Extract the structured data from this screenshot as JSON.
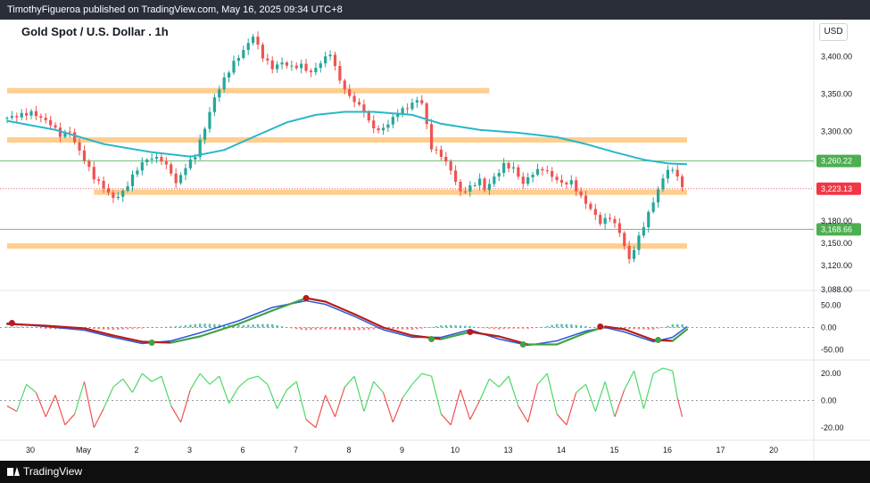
{
  "header": {
    "publisher_text": "TimothyFigueroa published on TradingView.com, May 16, 2025 09:34 UTC+8"
  },
  "chart_title": "Gold Spot / U.S. Dollar . 1h",
  "currency_label": "USD",
  "footer": {
    "brand": "TradingView"
  },
  "colors": {
    "up": "#26a69a",
    "down": "#ef5350",
    "ma": "#26b7c9",
    "zone": "#ffc57a",
    "green_level": "#4caf50",
    "red_level": "#f23645",
    "macd_fast": "#2a5bd7",
    "macd_slow_up": "#43a047",
    "macd_slow_down": "#b71c1c"
  },
  "chart_data": [
    {
      "type": "candlestick",
      "title": "Gold Spot / U.S. Dollar . 1h",
      "x_ticks": [
        "30",
        "May",
        "2",
        "3",
        "6",
        "7",
        "8",
        "9",
        "10",
        "13",
        "14",
        "15",
        "16",
        "17",
        "20"
      ],
      "y_ticks": [
        "3,400.00",
        "3,350.00",
        "3,300.00",
        "3,180.00",
        "3,150.00",
        "3,120.00",
        "3,088.00"
      ],
      "ylim": [
        3088,
        3440
      ],
      "price_path": [
        [
          0,
          3318
        ],
        [
          3,
          3322
        ],
        [
          5,
          3325
        ],
        [
          7,
          3318
        ],
        [
          9,
          3310
        ],
        [
          11,
          3295
        ],
        [
          13,
          3300
        ],
        [
          14,
          3285
        ],
        [
          16,
          3262
        ],
        [
          18,
          3238
        ],
        [
          20,
          3225
        ],
        [
          22,
          3210
        ],
        [
          24,
          3218
        ],
        [
          26,
          3240
        ],
        [
          28,
          3258
        ],
        [
          30,
          3265
        ],
        [
          32,
          3262
        ],
        [
          34,
          3245
        ],
        [
          35,
          3230
        ],
        [
          37,
          3252
        ],
        [
          39,
          3268
        ],
        [
          41,
          3305
        ],
        [
          43,
          3345
        ],
        [
          45,
          3370
        ],
        [
          47,
          3392
        ],
        [
          49,
          3408
        ],
        [
          51,
          3428
        ],
        [
          53,
          3400
        ],
        [
          55,
          3385
        ],
        [
          57,
          3392
        ],
        [
          59,
          3386
        ],
        [
          61,
          3388
        ],
        [
          63,
          3378
        ],
        [
          65,
          3392
        ],
        [
          67,
          3405
        ],
        [
          68,
          3385
        ],
        [
          70,
          3355
        ],
        [
          72,
          3340
        ],
        [
          74,
          3328
        ],
        [
          75,
          3312
        ],
        [
          77,
          3300
        ],
        [
          79,
          3310
        ],
        [
          81,
          3325
        ],
        [
          83,
          3332
        ],
        [
          85,
          3342
        ],
        [
          86,
          3338
        ],
        [
          88,
          3278
        ],
        [
          90,
          3268
        ],
        [
          92,
          3248
        ],
        [
          94,
          3218
        ],
        [
          96,
          3225
        ],
        [
          98,
          3235
        ],
        [
          99,
          3222
        ],
        [
          101,
          3238
        ],
        [
          103,
          3255
        ],
        [
          105,
          3250
        ],
        [
          107,
          3230
        ],
        [
          109,
          3244
        ],
        [
          111,
          3250
        ],
        [
          113,
          3240
        ],
        [
          115,
          3230
        ],
        [
          117,
          3232
        ],
        [
          119,
          3212
        ],
        [
          121,
          3196
        ],
        [
          123,
          3178
        ],
        [
          125,
          3185
        ],
        [
          127,
          3165
        ],
        [
          129,
          3128
        ],
        [
          131,
          3158
        ],
        [
          133,
          3190
        ],
        [
          135,
          3222
        ],
        [
          137,
          3250
        ],
        [
          139,
          3242
        ],
        [
          140,
          3223
        ]
      ],
      "moving_average": [
        [
          0,
          3314
        ],
        [
          10,
          3302
        ],
        [
          20,
          3283
        ],
        [
          30,
          3272
        ],
        [
          38,
          3266
        ],
        [
          45,
          3275
        ],
        [
          52,
          3295
        ],
        [
          58,
          3312
        ],
        [
          64,
          3322
        ],
        [
          70,
          3326
        ],
        [
          76,
          3326
        ],
        [
          84,
          3322
        ],
        [
          90,
          3310
        ],
        [
          98,
          3302
        ],
        [
          106,
          3298
        ],
        [
          114,
          3292
        ],
        [
          120,
          3283
        ],
        [
          126,
          3272
        ],
        [
          132,
          3262
        ],
        [
          137,
          3257
        ],
        [
          141,
          3256
        ]
      ],
      "zones": [
        {
          "from_x": 0,
          "to_x": 100,
          "low": 3351,
          "high": 3358
        },
        {
          "from_x": 0,
          "to_x": 141,
          "low": 3285,
          "high": 3292
        },
        {
          "from_x": 18,
          "to_x": 141,
          "low": 3215,
          "high": 3222
        },
        {
          "from_x": 0,
          "to_x": 141,
          "low": 3143,
          "high": 3150
        }
      ],
      "levels": [
        {
          "value": 3260.22,
          "label": "3,260.22",
          "color": "#4caf50",
          "style": "solid"
        },
        {
          "value": 3223.13,
          "label": "3,223.13",
          "color": "#f23645",
          "style": "dotted"
        },
        {
          "value": 3168.66,
          "label": "3,168.66",
          "color": "#4caf50",
          "style": "solid"
        }
      ]
    },
    {
      "type": "line",
      "indicator": "MACD",
      "y_ticks": [
        "50.00",
        "0.00",
        "-50.00"
      ],
      "ylim": [
        -65,
        75
      ],
      "fast_line": [
        [
          0,
          10
        ],
        [
          8,
          2
        ],
        [
          16,
          -6
        ],
        [
          22,
          -22
        ],
        [
          28,
          -36
        ],
        [
          34,
          -30
        ],
        [
          40,
          -12
        ],
        [
          48,
          15
        ],
        [
          55,
          45
        ],
        [
          62,
          60
        ],
        [
          66,
          52
        ],
        [
          72,
          25
        ],
        [
          78,
          -5
        ],
        [
          84,
          -22
        ],
        [
          90,
          -22
        ],
        [
          96,
          -5
        ],
        [
          102,
          -26
        ],
        [
          108,
          -40
        ],
        [
          114,
          -30
        ],
        [
          120,
          -8
        ],
        [
          124,
          0
        ],
        [
          128,
          -10
        ],
        [
          134,
          -32
        ],
        [
          138,
          -22
        ],
        [
          141,
          2
        ]
      ],
      "signal_line": [
        [
          0,
          8
        ],
        [
          8,
          4
        ],
        [
          16,
          -2
        ],
        [
          22,
          -18
        ],
        [
          28,
          -32
        ],
        [
          34,
          -34
        ],
        [
          40,
          -20
        ],
        [
          48,
          8
        ],
        [
          55,
          38
        ],
        [
          62,
          66
        ],
        [
          66,
          58
        ],
        [
          72,
          30
        ],
        [
          78,
          0
        ],
        [
          84,
          -18
        ],
        [
          90,
          -26
        ],
        [
          96,
          -10
        ],
        [
          102,
          -20
        ],
        [
          108,
          -38
        ],
        [
          114,
          -38
        ],
        [
          120,
          -12
        ],
        [
          124,
          2
        ],
        [
          128,
          -4
        ],
        [
          134,
          -28
        ],
        [
          138,
          -30
        ],
        [
          141,
          -4
        ]
      ],
      "cross_markers": [
        {
          "x": 1,
          "y": 10,
          "color": "#b71c1c"
        },
        {
          "x": 30,
          "y": -34,
          "color": "#43a047"
        },
        {
          "x": 62,
          "y": 66,
          "color": "#b71c1c"
        },
        {
          "x": 88,
          "y": -26,
          "color": "#43a047"
        },
        {
          "x": 96,
          "y": -10,
          "color": "#b71c1c"
        },
        {
          "x": 107,
          "y": -38,
          "color": "#43a047"
        },
        {
          "x": 123,
          "y": 2,
          "color": "#b71c1c"
        },
        {
          "x": 135,
          "y": -28,
          "color": "#43a047"
        }
      ]
    },
    {
      "type": "line",
      "indicator": "Oscillator",
      "y_ticks": [
        "20.00",
        "0.00",
        "-20.00"
      ],
      "ylim": [
        -28,
        28
      ],
      "path": [
        [
          0,
          -4
        ],
        [
          2,
          -8
        ],
        [
          4,
          12
        ],
        [
          6,
          6
        ],
        [
          8,
          -12
        ],
        [
          10,
          4
        ],
        [
          12,
          -18
        ],
        [
          14,
          -10
        ],
        [
          16,
          14
        ],
        [
          18,
          -20
        ],
        [
          20,
          -6
        ],
        [
          22,
          10
        ],
        [
          24,
          16
        ],
        [
          26,
          6
        ],
        [
          28,
          20
        ],
        [
          30,
          14
        ],
        [
          32,
          18
        ],
        [
          34,
          -4
        ],
        [
          36,
          -16
        ],
        [
          38,
          8
        ],
        [
          40,
          20
        ],
        [
          42,
          12
        ],
        [
          44,
          18
        ],
        [
          46,
          -2
        ],
        [
          48,
          10
        ],
        [
          50,
          16
        ],
        [
          52,
          18
        ],
        [
          54,
          12
        ],
        [
          56,
          -6
        ],
        [
          58,
          8
        ],
        [
          60,
          14
        ],
        [
          62,
          -14
        ],
        [
          64,
          -20
        ],
        [
          66,
          4
        ],
        [
          68,
          -12
        ],
        [
          70,
          10
        ],
        [
          72,
          18
        ],
        [
          74,
          -8
        ],
        [
          76,
          14
        ],
        [
          78,
          6
        ],
        [
          80,
          -16
        ],
        [
          82,
          2
        ],
        [
          84,
          12
        ],
        [
          86,
          20
        ],
        [
          88,
          18
        ],
        [
          90,
          -10
        ],
        [
          92,
          -18
        ],
        [
          94,
          8
        ],
        [
          96,
          -14
        ],
        [
          98,
          0
        ],
        [
          100,
          16
        ],
        [
          102,
          10
        ],
        [
          104,
          18
        ],
        [
          106,
          -4
        ],
        [
          108,
          -16
        ],
        [
          110,
          12
        ],
        [
          112,
          20
        ],
        [
          114,
          -10
        ],
        [
          116,
          -18
        ],
        [
          118,
          6
        ],
        [
          120,
          12
        ],
        [
          122,
          -8
        ],
        [
          124,
          14
        ],
        [
          126,
          -12
        ],
        [
          128,
          8
        ],
        [
          130,
          22
        ],
        [
          132,
          -6
        ],
        [
          134,
          20
        ],
        [
          136,
          24
        ],
        [
          138,
          22
        ],
        [
          139,
          2
        ],
        [
          140,
          -12
        ]
      ]
    }
  ]
}
